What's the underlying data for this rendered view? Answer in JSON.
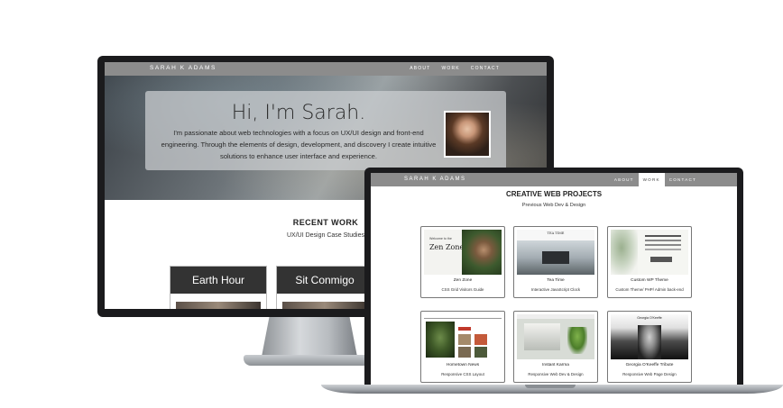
{
  "desktop": {
    "nav": {
      "brand": "SARAH K ADAMS",
      "links": [
        "ABOUT",
        "WORK",
        "CONTACT"
      ]
    },
    "hero": {
      "title": "Hi, I'm Sarah.",
      "text": "I'm passionate about web technologies with a focus on UX/UI design and front-end engineering. Through the elements of design, development, and discovery I create intuitive solutions to enhance user interface and experience."
    },
    "recent": {
      "title": "RECENT WORK",
      "subtitle": "UX/UI Design Case Studies",
      "cards": [
        "Earth Hour",
        "Sit Conmigo"
      ]
    }
  },
  "laptop": {
    "nav": {
      "brand": "SARAH K ADAMS",
      "links": [
        "ABOUT",
        "WORK",
        "CONTACT"
      ],
      "active": "WORK"
    },
    "title": "CREATIVE WEB PROJECTS",
    "subtitle": "Previous Web Dev & Design",
    "projects": [
      {
        "name": "Zen Zone",
        "desc": "CSS Grid Visitors Guide"
      },
      {
        "name": "Tea Time",
        "desc": "Interactive JavaScript Clock"
      },
      {
        "name": "Custom WP Theme",
        "desc": "Custom Theme/ PHP/ Admin back-end"
      },
      {
        "name": "Hometown News",
        "desc": "Responsive CSS Layout"
      },
      {
        "name": "Instant Karma",
        "desc": "Responsive Web Dev & Design"
      },
      {
        "name": "Georgia O'Keeffe Tribute",
        "desc": "Responsive Web Page Design"
      }
    ],
    "thumbs": {
      "zen_welcome": "Welcome to the",
      "zen_title": "Zen Zone",
      "tea_label": "TEA TIME",
      "okeeffe_label": "Georgia O'Keeffe"
    }
  }
}
